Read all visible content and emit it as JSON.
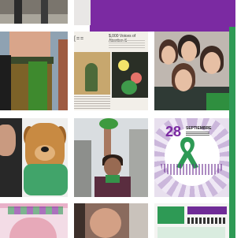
{
  "grid": {
    "poster": {
      "logo": "[==",
      "title": "$,000 Voices of Abortion S"
    },
    "event": {
      "day": "28",
      "month": "SEPTIEMBRE"
    }
  },
  "colors": {
    "header_purple": "#7b2aa2",
    "accent_green": "#2e9a55"
  }
}
